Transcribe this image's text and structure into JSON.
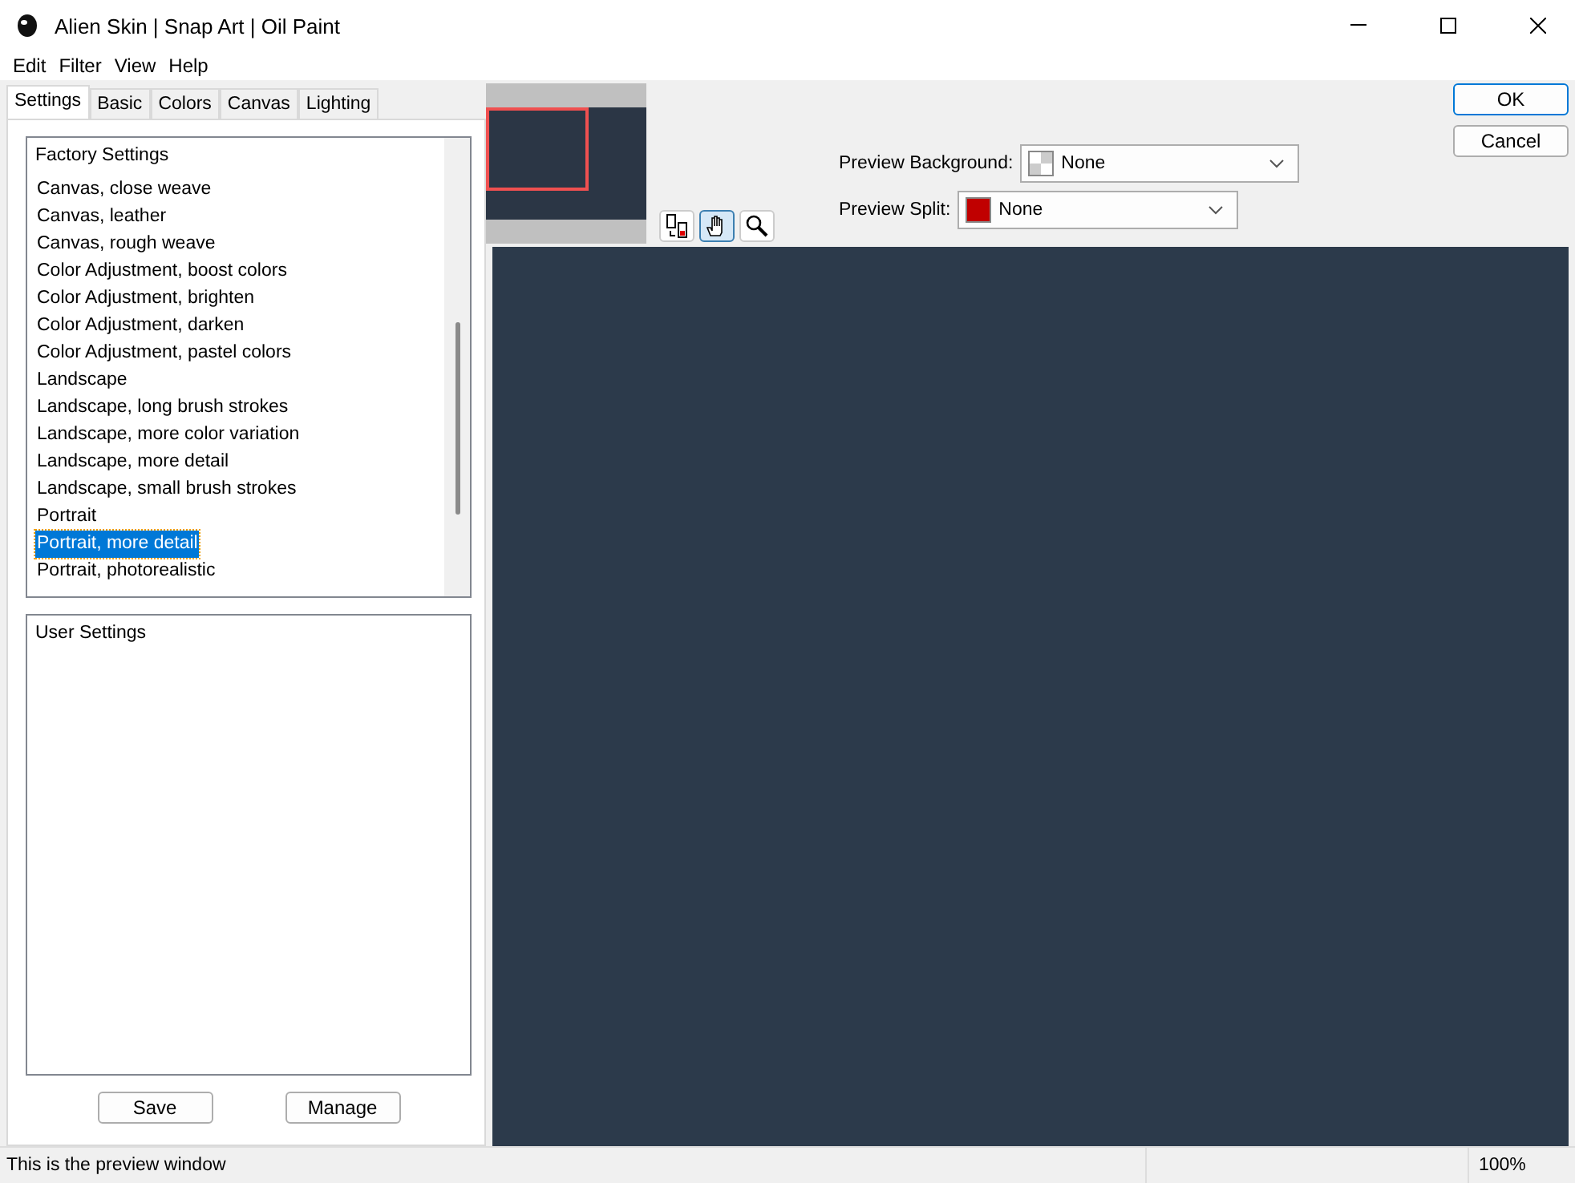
{
  "window": {
    "title": "Alien Skin | Snap Art | Oil Paint"
  },
  "menu": [
    "Edit",
    "Filter",
    "View",
    "Help"
  ],
  "tabs": [
    {
      "label": "Settings",
      "selected": true
    },
    {
      "label": "Basic",
      "selected": false
    },
    {
      "label": "Colors",
      "selected": false
    },
    {
      "label": "Canvas",
      "selected": false
    },
    {
      "label": "Lighting",
      "selected": false
    }
  ],
  "factory_settings": {
    "title": "Factory Settings",
    "items": [
      {
        "label": "Canvas, close weave",
        "selected": false
      },
      {
        "label": "Canvas, leather",
        "selected": false
      },
      {
        "label": "Canvas, rough weave",
        "selected": false
      },
      {
        "label": "Color Adjustment, boost colors",
        "selected": false
      },
      {
        "label": "Color Adjustment, brighten",
        "selected": false
      },
      {
        "label": "Color Adjustment, darken",
        "selected": false
      },
      {
        "label": "Color Adjustment, pastel colors",
        "selected": false
      },
      {
        "label": "Landscape",
        "selected": false
      },
      {
        "label": "Landscape, long brush strokes",
        "selected": false
      },
      {
        "label": "Landscape, more color variation",
        "selected": false
      },
      {
        "label": "Landscape, more detail",
        "selected": false
      },
      {
        "label": "Landscape, small brush strokes",
        "selected": false
      },
      {
        "label": "Portrait",
        "selected": false
      },
      {
        "label": "Portrait, more detail",
        "selected": true
      },
      {
        "label": "Portrait, photorealistic",
        "selected": false
      }
    ]
  },
  "user_settings": {
    "title": "User Settings"
  },
  "settings_buttons": [
    "Save",
    "Manage"
  ],
  "tools": [
    {
      "kind": "compare",
      "selected": false
    },
    {
      "kind": "hand",
      "selected": true
    },
    {
      "kind": "zoom",
      "selected": false
    }
  ],
  "preview_background": {
    "label": "Preview Background:",
    "value": "None"
  },
  "preview_split": {
    "label": "Preview Split:",
    "value": "None",
    "color": "#c00000"
  },
  "dialog_buttons": [
    "OK",
    "Cancel"
  ],
  "status_bar": {
    "message": "This is the preview window",
    "zoom": "100%"
  }
}
